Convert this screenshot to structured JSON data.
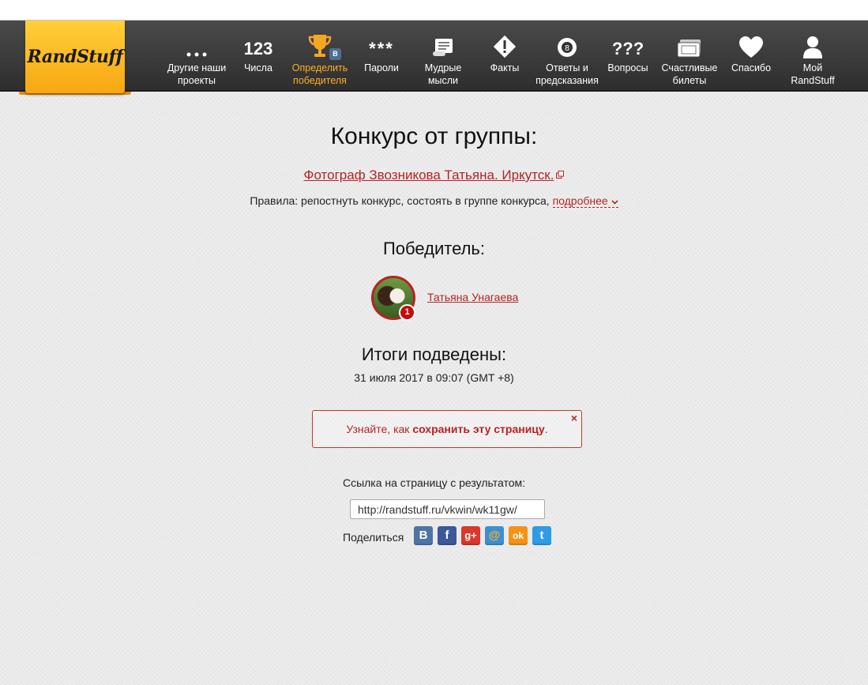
{
  "logo": {
    "text": "RandStuff"
  },
  "nav": [
    {
      "id": "other",
      "label1": "Другие наши",
      "label2": "проекты",
      "icon": "dots-icon",
      "active": false
    },
    {
      "id": "numbers",
      "label1": "Числа",
      "label2": "",
      "icon": "numbers-icon",
      "icon_text": "123",
      "active": false
    },
    {
      "id": "winner",
      "label1": "Определить",
      "label2": "победителя",
      "icon": "trophy-icon",
      "badge": "В",
      "active": true
    },
    {
      "id": "passwords",
      "label1": "Пароли",
      "label2": "",
      "icon": "asterisks-icon",
      "icon_text": "***",
      "active": false
    },
    {
      "id": "thoughts",
      "label1": "Мудрые",
      "label2": "мысли",
      "icon": "scroll-icon",
      "active": false
    },
    {
      "id": "facts",
      "label1": "Факты",
      "label2": "",
      "icon": "exclamation-icon",
      "active": false
    },
    {
      "id": "answers",
      "label1": "Ответы и",
      "label2": "предсказания",
      "icon": "eight-ball-icon",
      "active": false
    },
    {
      "id": "questions",
      "label1": "Вопросы",
      "label2": "",
      "icon": "question-marks-icon",
      "icon_text": "???",
      "active": false
    },
    {
      "id": "tickets",
      "label1": "Счастливые",
      "label2": "билеты",
      "icon": "ticket-icon",
      "active": false
    },
    {
      "id": "thanks",
      "label1": "Спасибо",
      "label2": "",
      "icon": "heart-icon",
      "active": false
    },
    {
      "id": "my",
      "label1": "Мой",
      "label2": "RandStuff",
      "icon": "user-icon",
      "active": false
    }
  ],
  "contest": {
    "title": "Конкурс от группы:",
    "group_name": "Фотограф Звозникова Татьяна. Иркутск.",
    "rules_text": "Правила: репостнуть конкурс, состоять в группе конкурса, ",
    "rules_more": "подробнее"
  },
  "winner": {
    "title": "Победитель:",
    "place": "1",
    "name": "Татьяна Унагаева"
  },
  "results": {
    "title": "Итоги подведены:",
    "date": "31 июля 2017 в 09:07 (GMT +8)"
  },
  "notice": {
    "text_prefix": "Узнайте, как ",
    "text_bold": "сохранить эту страницу",
    "text_suffix": ".",
    "close": "×"
  },
  "share": {
    "link_label": "Ссылка на страницу с результатом:",
    "link_value": "http://randstuff.ru/vkwin/wk11gw/",
    "share_label": "Поделиться",
    "buttons": [
      {
        "id": "vk",
        "glyph": "B",
        "color": "#4d74a3"
      },
      {
        "id": "facebook",
        "glyph": "f",
        "color": "#3b5998"
      },
      {
        "id": "google-plus",
        "glyph": "g+",
        "color": "#d8392b"
      },
      {
        "id": "mailru",
        "glyph": "@",
        "color": "#3d8fd1"
      },
      {
        "id": "odnoklassniki",
        "glyph": "ok",
        "color": "#f59215"
      },
      {
        "id": "twitter",
        "glyph": "t",
        "color": "#2d9be6"
      }
    ]
  },
  "colors": {
    "accent": "#b52323",
    "active_nav": "#ffb020",
    "logo": "#f7a712"
  }
}
